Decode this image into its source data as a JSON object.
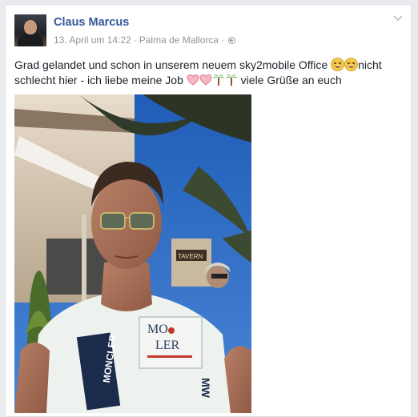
{
  "post": {
    "author": "Claus Marcus",
    "date": "13. April um 14:22",
    "separator": "·",
    "location": "Palma de Mallorca",
    "text_part1": "Grad gelandet und schon in unserem neuem sky2mobile Office",
    "text_part2": "nicht schlecht hier - ich liebe meine Job",
    "text_part3": "viele Grüße an euch",
    "photo": {
      "shirt_brand_top": "MONCLER",
      "shirt_brand_badge_1": "MO",
      "shirt_brand_badge_2": "LER",
      "shirt_side_text": "MW",
      "sign_text": "TAVERN"
    }
  },
  "icons": {
    "audience": "globe-icon",
    "menu": "chevron-down-icon",
    "emoji_laugh": "laughing-emoji-icon",
    "emoji_heart": "heart-emoji-icon",
    "emoji_palm": "palm-tree-emoji-icon"
  },
  "colors": {
    "name_link": "#365899",
    "meta_gray": "#90949c",
    "text": "#1d2129",
    "card_border": "#dddfe2",
    "page_bg": "#e9ebee"
  }
}
